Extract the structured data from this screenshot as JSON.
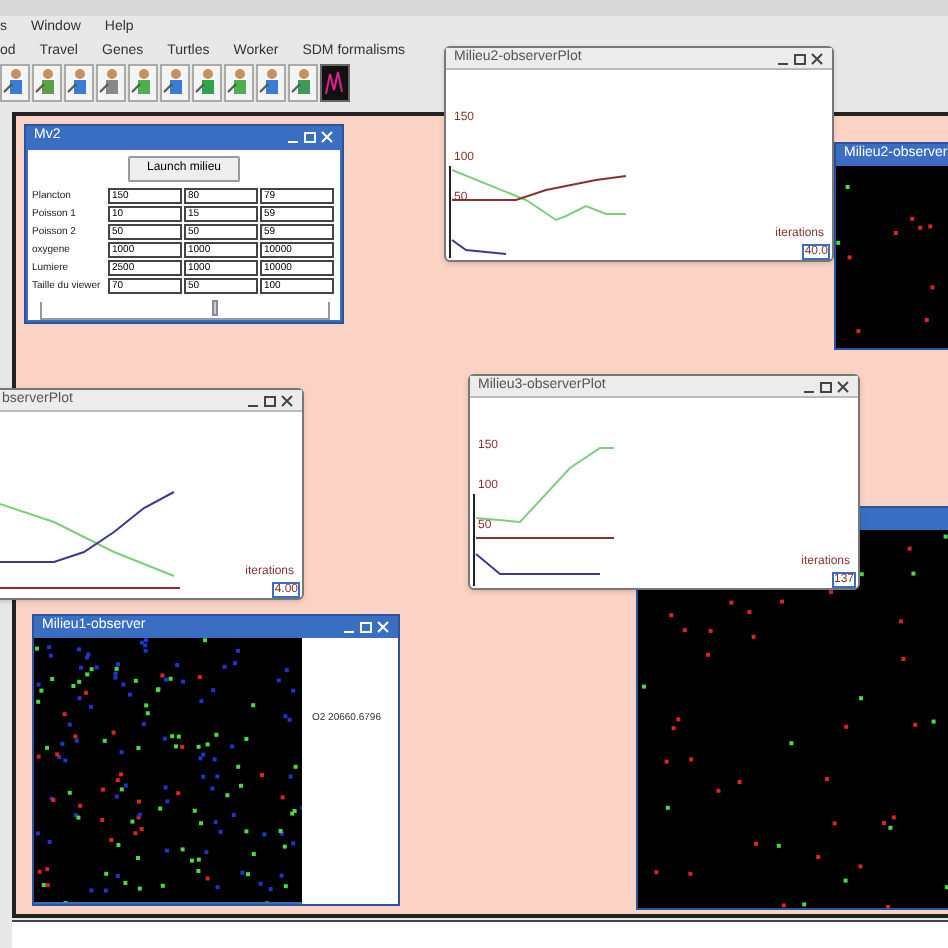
{
  "menu_bar": [
    "s",
    "Window",
    "Help"
  ],
  "menu_bar_2": [
    "od",
    "Travel",
    "Genes",
    "Turtles",
    "Worker",
    "SDM formalisms"
  ],
  "windows": [
    {
      "kind": "plot",
      "title": "Milieu2-observerPlot",
      "y_labels": [
        "150",
        "100",
        "50"
      ],
      "x_label": "iterations",
      "x_max": "40.0"
    },
    {
      "kind": "form",
      "title": "Mv2",
      "button": "Launch milieu",
      "rows": [
        {
          "label": "Plancton",
          "values": [
            "150",
            "80",
            "79"
          ]
        },
        {
          "label": "Poisson 1",
          "values": [
            "10",
            "15",
            "59"
          ]
        },
        {
          "label": "Poisson 2",
          "values": [
            "50",
            "50",
            "59"
          ]
        },
        {
          "label": "oxygene",
          "values": [
            "1000",
            "1000",
            "10000"
          ]
        },
        {
          "label": "Lumiere",
          "values": [
            "2500",
            "1000",
            "10000"
          ]
        },
        {
          "label": "Taille du viewer",
          "values": [
            "70",
            "50",
            "100"
          ]
        }
      ],
      "slider": {
        "level": 0.6
      }
    },
    {
      "kind": "observer",
      "title": "Milieu2-observer"
    },
    {
      "kind": "plot",
      "title": "Milieu3-observerPlot",
      "y_labels": [
        "150",
        "100",
        "50"
      ],
      "x_label": "iterations",
      "x_max": "137"
    },
    {
      "kind": "plot",
      "title": "bserverPlot",
      "x_label": "iterations",
      "x_max": "4.00"
    },
    {
      "kind": "observer"
    },
    {
      "kind": "observer",
      "title": "Milieu1-observer",
      "side_text": "O2 20660.6796"
    }
  ]
}
